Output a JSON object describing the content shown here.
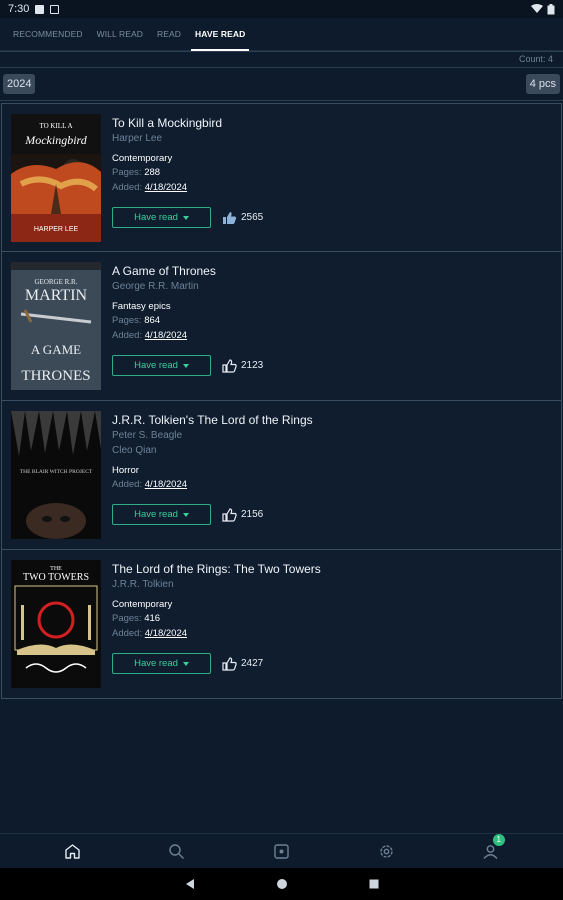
{
  "status_bar": {
    "time": "7:30"
  },
  "tabs": [
    {
      "label": "RECOMMENDED"
    },
    {
      "label": "WILL READ"
    },
    {
      "label": "READ"
    },
    {
      "label": "HAVE READ"
    }
  ],
  "count_label": "Count: 4",
  "group": {
    "year": "2024",
    "pieces": "4 pcs"
  },
  "labels": {
    "pages": "Pages:",
    "added": "Added:"
  },
  "books": [
    {
      "title": "To Kill a Mockingbird",
      "authors": [
        "Harper Lee"
      ],
      "genre": "Contemporary",
      "pages": "288",
      "added": "4/18/2024",
      "status": "Have read",
      "likes": "2565",
      "cover_text": [
        "TO KILL A",
        "Mockingbird",
        "HARPER LEE"
      ],
      "liked": true
    },
    {
      "title": "A Game of Thrones",
      "authors": [
        "George R.R. Martin"
      ],
      "genre": "Fantasy epics",
      "pages": "864",
      "added": "4/18/2024",
      "status": "Have read",
      "likes": "2123",
      "cover_text": [
        "GEORGE R.R.",
        "MARTIN",
        "A GAME",
        "THRONES"
      ],
      "liked": false
    },
    {
      "title": "J.R.R. Tolkien's The Lord of the Rings",
      "authors": [
        "Peter S. Beagle",
        "Cleo Qian"
      ],
      "genre": "Horror",
      "pages": "",
      "added": "4/18/2024",
      "status": "Have read",
      "likes": "2156",
      "cover_text": [
        "THE BLAIR WITCH PROJECT"
      ],
      "liked": false
    },
    {
      "title": "The Lord of the Rings: The Two Towers",
      "authors": [
        "J.R.R. Tolkien"
      ],
      "genre": "Contemporary",
      "pages": "416",
      "added": "4/18/2024",
      "status": "Have read",
      "likes": "2427",
      "cover_text": [
        "THE",
        "TWO TOWERS"
      ],
      "liked": false
    }
  ],
  "bottom_nav": [
    {
      "icon": "home-icon"
    },
    {
      "icon": "search-icon"
    },
    {
      "icon": "add-icon"
    },
    {
      "icon": "settings-icon"
    },
    {
      "icon": "profile-icon",
      "badge": "1"
    }
  ],
  "colors": {
    "accent": "#3ccf9c",
    "background": "#0e1b2c"
  }
}
